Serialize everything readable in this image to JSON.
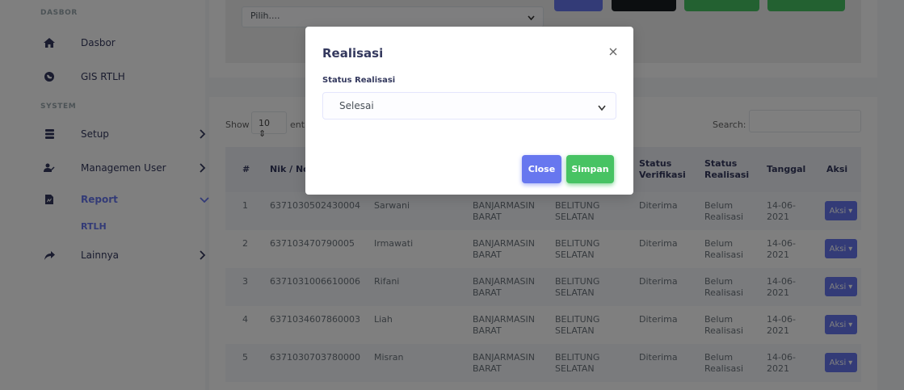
{
  "sidebar": {
    "section_dasbor": "DASBOR",
    "section_system": "SYSTEM",
    "items": [
      {
        "label": "Dasbor"
      },
      {
        "label": "GIS RTLH"
      },
      {
        "label": "Setup"
      },
      {
        "label": "Managemen User"
      },
      {
        "label": "Report"
      },
      {
        "label": "Lainnya"
      }
    ],
    "sub_rtlh": "RTLH"
  },
  "filter": {
    "select_value": "Pilih...."
  },
  "table": {
    "show_label": "Show",
    "length_value": "10",
    "entries_label": "entr",
    "search_label": "Search:",
    "headers": {
      "no": "#",
      "nik": "Nik / No.",
      "status_verifikasi": [
        "Status",
        "Verifikasi"
      ],
      "status_realisasi": [
        "Status",
        "Realisasi"
      ],
      "tanggal": "Tanggal",
      "aksi": "Aksi"
    },
    "rows": [
      {
        "no": "1",
        "nik": "6371030502430004",
        "nama": "Sarwani",
        "kecamatan": [
          "BANJARMASIN",
          "BARAT"
        ],
        "kelurahan": [
          "BELITUNG",
          "SELATAN"
        ],
        "verifikasi": "Diterima",
        "realisasi": [
          "Belum",
          "Realisasi"
        ],
        "tanggal": [
          "14-06-",
          "2021"
        ],
        "aksi": "Aksi"
      },
      {
        "no": "2",
        "nik": "637103470790005",
        "nama": "Irmawati",
        "kecamatan": [
          "BANJARMASIN",
          "BARAT"
        ],
        "kelurahan": [
          "BELITUNG",
          "SELATAN"
        ],
        "verifikasi": "Diterima",
        "realisasi": [
          "Belum",
          "Realisasi"
        ],
        "tanggal": [
          "14-06-",
          "2021"
        ],
        "aksi": "Aksi"
      },
      {
        "no": "3",
        "nik": "6371031006610006",
        "nama": "Rifani",
        "kecamatan": [
          "BANJARMASIN",
          "BARAT"
        ],
        "kelurahan": [
          "BELITUNG",
          "SELATAN"
        ],
        "verifikasi": "Diterima",
        "realisasi": [
          "Belum",
          "Realisasi"
        ],
        "tanggal": [
          "14-06-",
          "2021"
        ],
        "aksi": "Aksi"
      },
      {
        "no": "4",
        "nik": "6371034607860003",
        "nama": "Liah",
        "kecamatan": [
          "BANJARMASIN",
          "BARAT"
        ],
        "kelurahan": [
          "BELITUNG",
          "SELATAN"
        ],
        "verifikasi": "Diterima",
        "realisasi": [
          "Belum",
          "Realisasi"
        ],
        "tanggal": [
          "14-06-",
          "2021"
        ],
        "aksi": "Aksi"
      },
      {
        "no": "5",
        "nik": "6371030703780000",
        "nama": "Misran",
        "kecamatan": [
          "BANJARMASIN",
          "BARAT"
        ],
        "kelurahan": [
          "BELITUNG",
          "SELATAN"
        ],
        "verifikasi": "Diterima",
        "realisasi": [
          "Belum",
          "Realisasi"
        ],
        "tanggal": [
          "14-06-",
          "2021"
        ],
        "aksi": "Aksi"
      }
    ]
  },
  "modal": {
    "title": "Realisasi",
    "field_label": "Status Realisasi",
    "select_value": "Selesai",
    "close_label": "Close",
    "save_label": "Simpan"
  },
  "colors": {
    "primary": "#6777ef",
    "success": "#47c363",
    "dark": "#191d21"
  }
}
